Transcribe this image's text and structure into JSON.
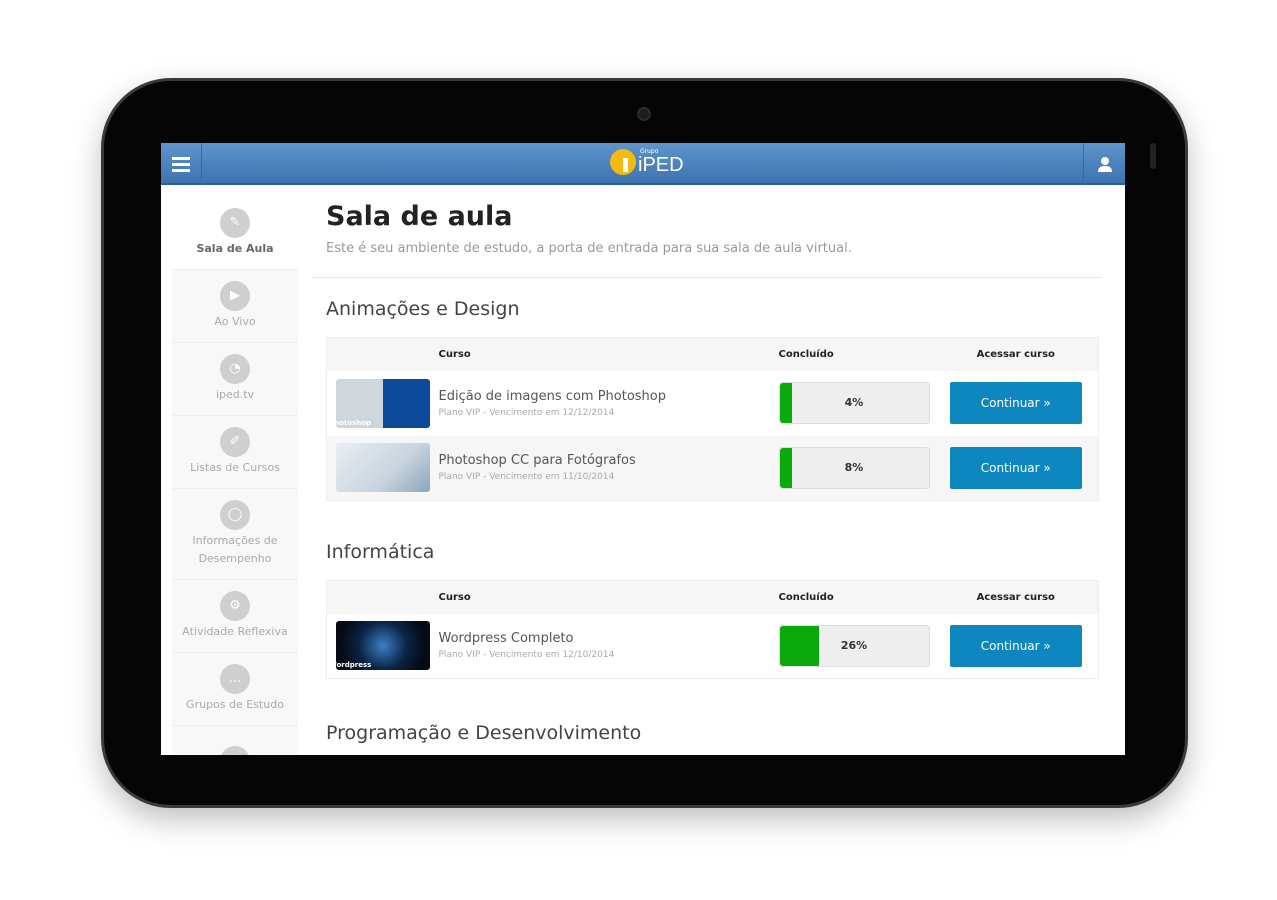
{
  "header": {
    "logo_group": "Grupo",
    "logo_text": "iPED"
  },
  "sidebar": {
    "items": [
      {
        "label": "Sala de Aula",
        "icon": "teacher-icon"
      },
      {
        "label": "Ao Vivo",
        "icon": "play-icon"
      },
      {
        "label": "iped.tv",
        "icon": "iped-tv-icon"
      },
      {
        "label": "Listas de Cursos",
        "icon": "list-edit-icon"
      },
      {
        "label": "Informações de Desempenho",
        "icon": "donut-chart-icon"
      },
      {
        "label": "Atividade Reflexiva",
        "icon": "head-gears-icon"
      },
      {
        "label": "Grupos de Estudo",
        "icon": "chat-icon"
      }
    ]
  },
  "page": {
    "title": "Sala de aula",
    "subtitle": "Este é seu ambiente de estudo, a porta de entrada para sua sala de aula virtual."
  },
  "table_headers": {
    "course": "Curso",
    "done": "Concluído",
    "access": "Acessar curso"
  },
  "sections": [
    {
      "title": "Animações e Design",
      "courses": [
        {
          "name": "Edição de imagens com Photoshop",
          "meta": "Plano VIP - Vencimento em 12/12/2014",
          "progress": 4,
          "progress_label": "4%",
          "button": "Continuar »",
          "thumb_label": "Photoshop"
        },
        {
          "name": "Photoshop CC para Fotógrafos",
          "meta": "Plano VIP - Vencimento em 11/10/2014",
          "progress": 8,
          "progress_label": "8%",
          "button": "Continuar »"
        }
      ]
    },
    {
      "title": "Informática",
      "courses": [
        {
          "name": "Wordpress Completo",
          "meta": "Plano VIP - Vencimento em 12/10/2014",
          "progress": 26,
          "progress_label": "26%",
          "button": "Continuar »",
          "thumb_label": "Wordpress"
        }
      ]
    },
    {
      "title": "Programação e Desenvolvimento",
      "courses": []
    }
  ],
  "colors": {
    "header": "#4a80bd",
    "progress": "#0aaa0a",
    "button": "#0e87c1",
    "logo": "#f6b912"
  }
}
